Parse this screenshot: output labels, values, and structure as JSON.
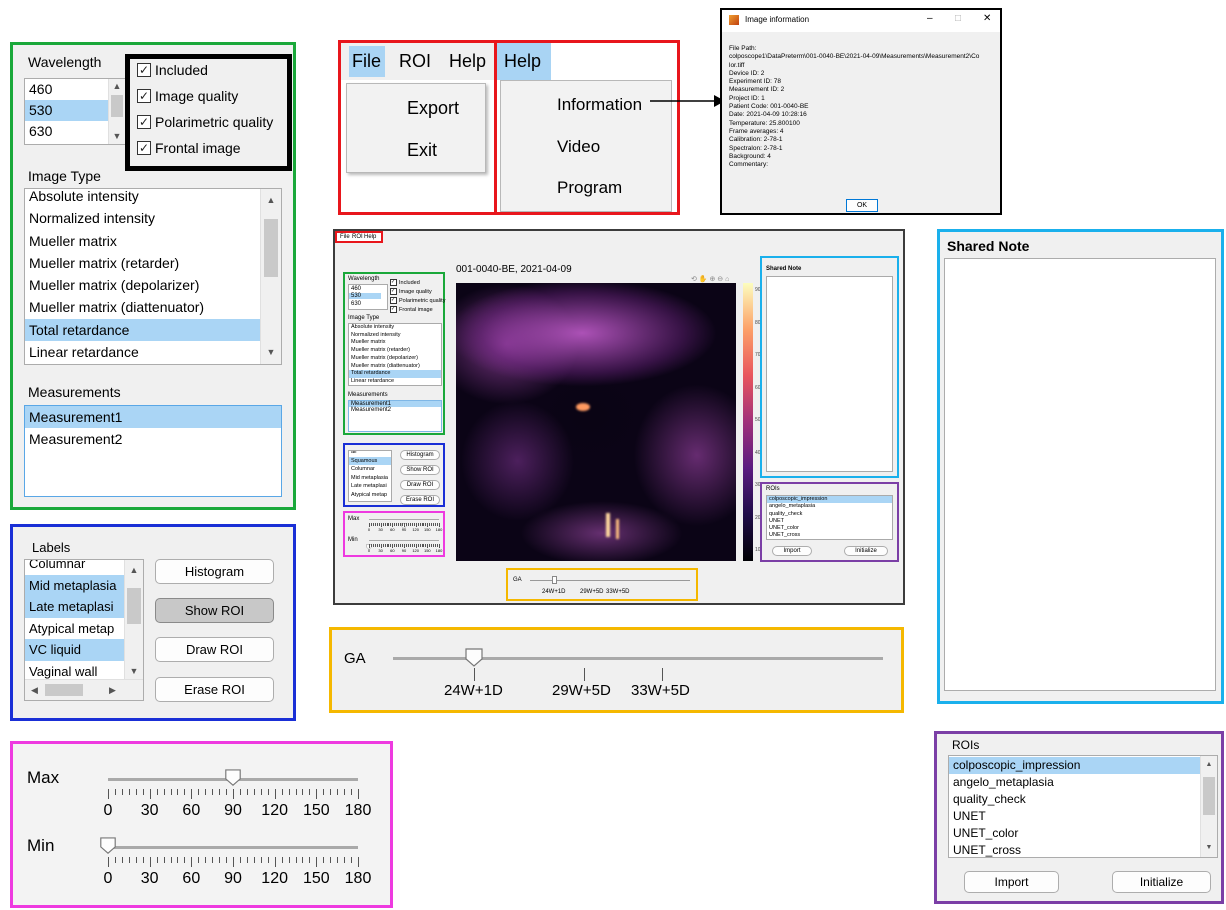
{
  "ui": {
    "wavelength": {
      "title": "Wavelength",
      "items": [
        "460",
        "530",
        "630"
      ],
      "selected": 1
    },
    "checks": {
      "items": [
        "Included",
        "Image quality",
        "Polarimetric quality",
        "Frontal image"
      ]
    },
    "image_type": {
      "title": "Image Type",
      "items": [
        "Absolute intensity",
        "Normalized intensity",
        "Mueller matrix",
        "Mueller matrix (retarder)",
        "Mueller matrix (depolarizer)",
        "Mueller matrix (diattenuator)",
        "Total retardance",
        "Linear retardance"
      ],
      "selected": 6
    },
    "measurements": {
      "title": "Measurements",
      "items": [
        "Measurement1",
        "Measurement2"
      ]
    },
    "labels": {
      "title": "Labels",
      "items": [
        "Columnar",
        "Mid metaplasia",
        "Late metaplasi",
        "Atypical metap",
        "VC liquid",
        "Vaginal wall"
      ],
      "selected": [
        1,
        2,
        4
      ]
    },
    "buttons": {
      "histogram": "Histogram",
      "show_roi": "Show ROI",
      "draw_roi": "Draw ROI",
      "erase_roi": "Erase ROI",
      "import": "Import",
      "initialize": "Initialize"
    },
    "sliders": {
      "max_label": "Max",
      "min_label": "Min",
      "max_value": 90,
      "min_value": 0,
      "range": [
        0,
        180
      ],
      "tick_labels": [
        "0",
        "30",
        "60",
        "90",
        "120",
        "150",
        "180"
      ]
    },
    "menubar": [
      "File",
      "ROI",
      "Help"
    ],
    "file_menu": [
      "Export",
      "Exit"
    ],
    "help_title": "Help",
    "help_menu": [
      "Information",
      "Video",
      "Program"
    ],
    "ga": {
      "label": "GA",
      "tick_labels": [
        "24W+1D",
        "29W+5D",
        "33W+5D"
      ],
      "value": "24W+1D"
    },
    "shared_note": {
      "title": "Shared Note"
    },
    "rois": {
      "title": "ROIs",
      "items": [
        "colposcopic_impression",
        "angelo_metaplasia",
        "quality_check",
        "UNET",
        "UNET_color",
        "UNET_cross"
      ],
      "selected": 0
    },
    "image_info": {
      "title": "Image information",
      "lines": [
        "File Path:",
        "colposcope1\\DataPreterm\\001-0040-BE\\2021-04-09\\Measurements\\Measurement2\\Co",
        "lor.tiff",
        "Device ID: 2",
        "Experiment ID: 78",
        "Measurement ID: 2",
        "Project ID: 1",
        "Patient Code: 001-0040-BE",
        "Date: 2021-04-09 10:28:16",
        "Temperature: 25.800100",
        "Frame averages: 4",
        "Calibration: 2-78-1",
        "Spectralon: 2-78-1",
        "Background: 4",
        "Commentary:"
      ],
      "ok": "OK",
      "controls": [
        "–",
        "□",
        "✕"
      ]
    },
    "main_window": {
      "title": "001-0040-BE, 2021-04-09",
      "colorbar_ticks": [
        "90",
        "80",
        "70",
        "60",
        "50",
        "40",
        "30",
        "20",
        "10"
      ],
      "labels_short": [
        "Labels",
        "all",
        "Squamous",
        "Columnar",
        "Mid metaplasia",
        "Late metaplasi",
        "Atypical metap"
      ]
    },
    "colors": {
      "green": "#1aa83a",
      "black": "#000000",
      "red": "#e8161c",
      "blue": "#1a2fd6",
      "magenta": "#ee3ae0",
      "gold": "#f5b800",
      "cyan": "#1ab0ec",
      "purple": "#7b3fa6",
      "selection": "#aad5f5"
    }
  }
}
